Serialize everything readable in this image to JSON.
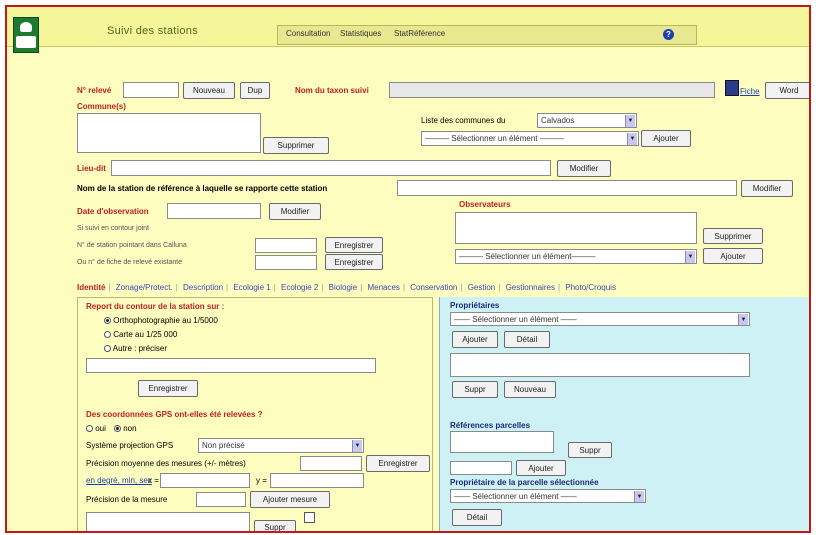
{
  "header": {
    "brand": "Suivi des stations",
    "menu": [
      "Consultation",
      "Statistiques",
      "StatRéférence"
    ]
  },
  "top": {
    "releve_label": "N° relevé",
    "nouveau_btn": "Nouveau",
    "dup_btn": "Dup",
    "taxon_label": "Nom du taxon suivi",
    "fiche_link": "Fiche",
    "word_btn": "Word",
    "communes_label": "Commune(s)",
    "supprimer_btn": "Supprimer",
    "liste_communes_label": "Liste des communes du",
    "departement_value": "Calvados",
    "select_placeholder": "——— Sélectionner un élément ———",
    "ajouter_btn": "Ajouter",
    "lieu_dit_label": "Lieu-dit",
    "modifier_btn": "Modifier",
    "station_ref_label": "Nom de la station de référence à laquelle se rapporte cette station",
    "date_label": "Date d'observation",
    "contour_label": "Si suivi en contour joint",
    "num_station_label": "N° de station pointant dans Calluna",
    "num_fiche_label": "Ou n° de fiche de relevé existante",
    "enregistrer_btn": "Enregistrer",
    "observateurs_label": "Observateurs",
    "select_placeholder_2": "——— Sélectionner un élément———"
  },
  "tabs": [
    "Identité",
    "Zonage/Protect.",
    "Description",
    "Ecologie 1",
    "Ecologie 2",
    "Biologie",
    "Menaces",
    "Conservation",
    "Gestion",
    "Gestionnaires",
    "Photo/Croquis"
  ],
  "left": {
    "report_title": "Report du contour de la station sur :",
    "options": [
      "Orthophotographie au 1/5000",
      "Carte au 1/25 000",
      "Autre : préciser"
    ],
    "enregistrer": "Enregistrer",
    "gps_question": "Des coordonnées GPS ont-elles été relevées ?",
    "oui": "oui",
    "non": "non",
    "systeme_label": "Système projection GPS",
    "systeme_value": "Non précisé",
    "precision_moy_label": "Précision moyenne des mesures (+/- mètres)",
    "enregistrer_2": "Enregistrer",
    "coord_link": "en degré, min, sec",
    "x_label": "x =",
    "y_label": "y =",
    "precision_label": "Précision de la mesure",
    "ajouter_mesure": "Ajouter mesure",
    "suppr": "Suppr"
  },
  "right": {
    "proprietaires_title": "Propriétaires",
    "select_placeholder": "—— Sélectionner un élément ——",
    "ajouter": "Ajouter",
    "detail": "Détail",
    "suppr": "Suppr",
    "nouveau": "Nouveau",
    "ref_parcelles_title": "Références parcelles",
    "suppr2": "Suppr",
    "ajouter2": "Ajouter",
    "proprio_parcelle_title": "Propriétaire de la parcelle sélectionnée",
    "select_placeholder_3": "—— Sélectionner un élément ——",
    "detail2": "Détail"
  }
}
